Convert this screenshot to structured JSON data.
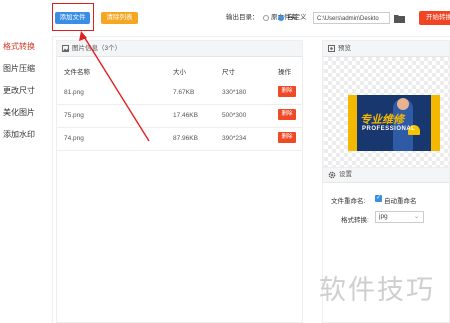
{
  "sidebar": {
    "items": [
      {
        "label": "格式转换",
        "active": true
      },
      {
        "label": "图片压缩",
        "active": false
      },
      {
        "label": "更改尺寸",
        "active": false
      },
      {
        "label": "美化图片",
        "active": false
      },
      {
        "label": "添加水印",
        "active": false
      }
    ]
  },
  "toolbar": {
    "add_file_label": "添加文件",
    "clear_list_label": "清除列表",
    "output_dir_label": "输出目录：",
    "option_source": "原文件夹",
    "option_custom": "自定义",
    "output_path": "C:\\Users\\admin\\Deskto",
    "start_label": "开始转换"
  },
  "list": {
    "title": "图片信息（3个）",
    "headers": {
      "name": "文件名称",
      "size": "大小",
      "dims": "尺寸",
      "action": "操作"
    },
    "rows": [
      {
        "name": "81.png",
        "size": "7.67KB",
        "dims": "330*180",
        "action": "删除"
      },
      {
        "name": "75.png",
        "size": "17.46KB",
        "dims": "500*300",
        "action": "删除"
      },
      {
        "name": "74.png",
        "size": "87.96KB",
        "dims": "390*234",
        "action": "删除"
      }
    ]
  },
  "preview": {
    "title": "预览",
    "banner_text1": "专业维修",
    "banner_text2": "PROFESSIONAL"
  },
  "settings": {
    "title": "设置",
    "rename_label": "文件重命名:",
    "auto_rename_label": "自动重命名",
    "auto_rename_checked": true,
    "format_label": "格式转换:",
    "format_value": "jpg"
  },
  "watermark": "软件技巧",
  "colors": {
    "accent_red": "#d83a2a",
    "button_blue": "#3a8ee6",
    "button_orange": "#f5a623",
    "delete_red": "#ef4a25"
  }
}
